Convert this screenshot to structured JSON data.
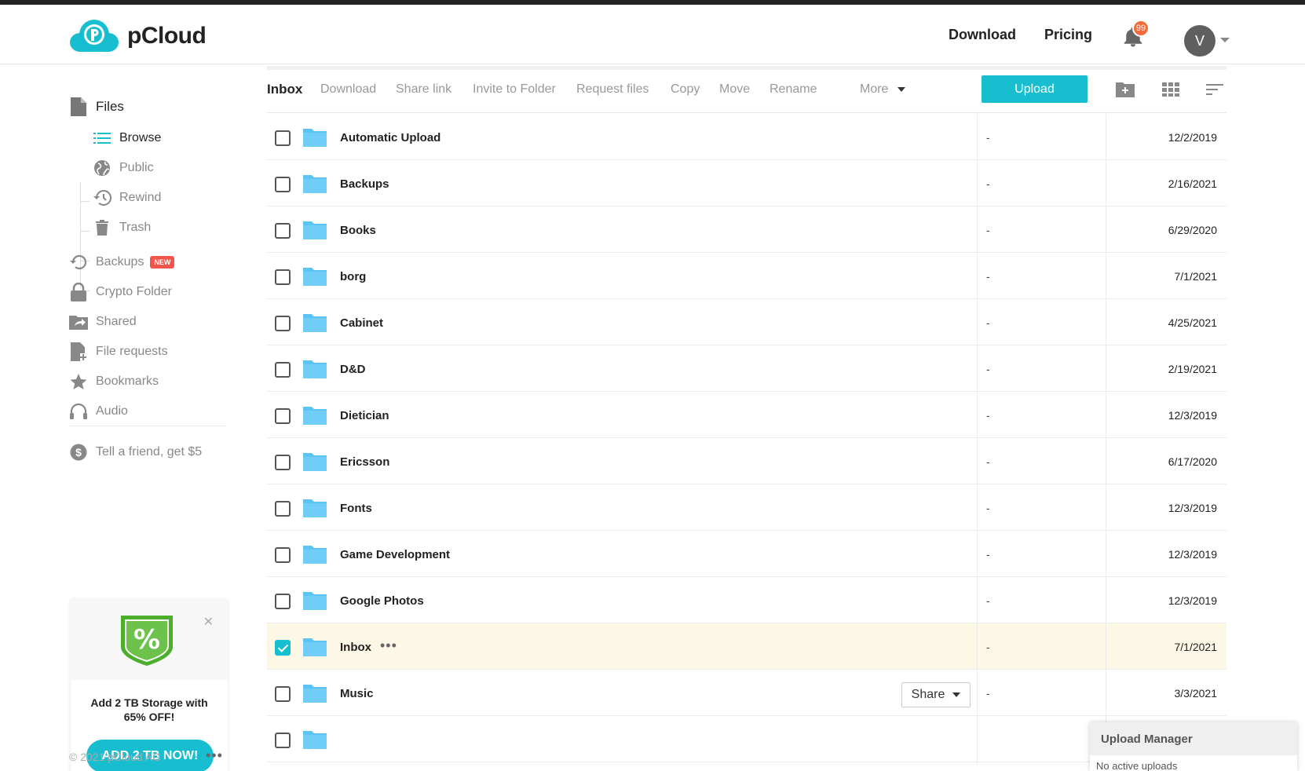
{
  "header": {
    "brand": "pCloud",
    "links": [
      {
        "label": "Download"
      },
      {
        "label": "Pricing"
      }
    ],
    "notifications_count": "99",
    "avatar_initial": "V"
  },
  "sidebar": {
    "files_label": "Files",
    "sub_items": [
      {
        "label": "Browse",
        "icon": "list-icon"
      },
      {
        "label": "Public",
        "icon": "globe-icon"
      },
      {
        "label": "Rewind",
        "icon": "history-icon"
      },
      {
        "label": "Trash",
        "icon": "trash-icon"
      }
    ],
    "items": [
      {
        "label": "Backups",
        "icon": "backup-icon"
      },
      {
        "label": "Crypto Folder",
        "icon": "lock-icon"
      },
      {
        "label": "Shared",
        "icon": "share-folder-icon"
      },
      {
        "label": "File requests",
        "icon": "file-request-icon"
      },
      {
        "label": "Bookmarks",
        "icon": "star-icon"
      },
      {
        "label": "Audio",
        "icon": "headphones-icon"
      }
    ],
    "new_badge": "NEW",
    "referral": "Tell a friend, get $5",
    "promo": {
      "badge_symbol": "%",
      "text": "Add 2 TB Storage with 65% OFF!",
      "button": "ADD 2 TB NOW!"
    },
    "copyright": "© 2021 pCloud AG"
  },
  "toolbar": {
    "title": "Inbox",
    "actions": [
      "Download",
      "Share link",
      "Invite to Folder",
      "Request files",
      "Copy",
      "Move",
      "Rename"
    ],
    "more": "More",
    "upload": "Upload"
  },
  "files": [
    {
      "name": "Automatic Upload",
      "size": "-",
      "date": "12/2/2019"
    },
    {
      "name": "Backups",
      "size": "-",
      "date": "2/16/2021"
    },
    {
      "name": "Books",
      "size": "-",
      "date": "6/29/2020"
    },
    {
      "name": "borg",
      "size": "-",
      "date": "7/1/2021"
    },
    {
      "name": "Cabinet",
      "size": "-",
      "date": "4/25/2021"
    },
    {
      "name": "D&D",
      "size": "-",
      "date": "2/19/2021"
    },
    {
      "name": "Dietician",
      "size": "-",
      "date": "12/3/2019"
    },
    {
      "name": "Ericsson",
      "size": "-",
      "date": "6/17/2020"
    },
    {
      "name": "Fonts",
      "size": "-",
      "date": "12/3/2019"
    },
    {
      "name": "Game Development",
      "size": "-",
      "date": "12/3/2019"
    },
    {
      "name": "Google Photos",
      "size": "-",
      "date": "12/3/2019"
    },
    {
      "name": "Inbox",
      "size": "-",
      "date": "7/1/2021",
      "selected": true
    },
    {
      "name": "Music",
      "size": "-",
      "date": "3/3/2021",
      "share": "Share"
    },
    {
      "name": "",
      "size": "",
      "date": ""
    }
  ],
  "upload_manager": {
    "title": "Upload Manager",
    "status": "No active uploads"
  },
  "colors": {
    "accent": "#17bed0",
    "folder": "#5bc4f5",
    "selected_row": "#fdf8e6",
    "badge": "#f26b3a"
  }
}
